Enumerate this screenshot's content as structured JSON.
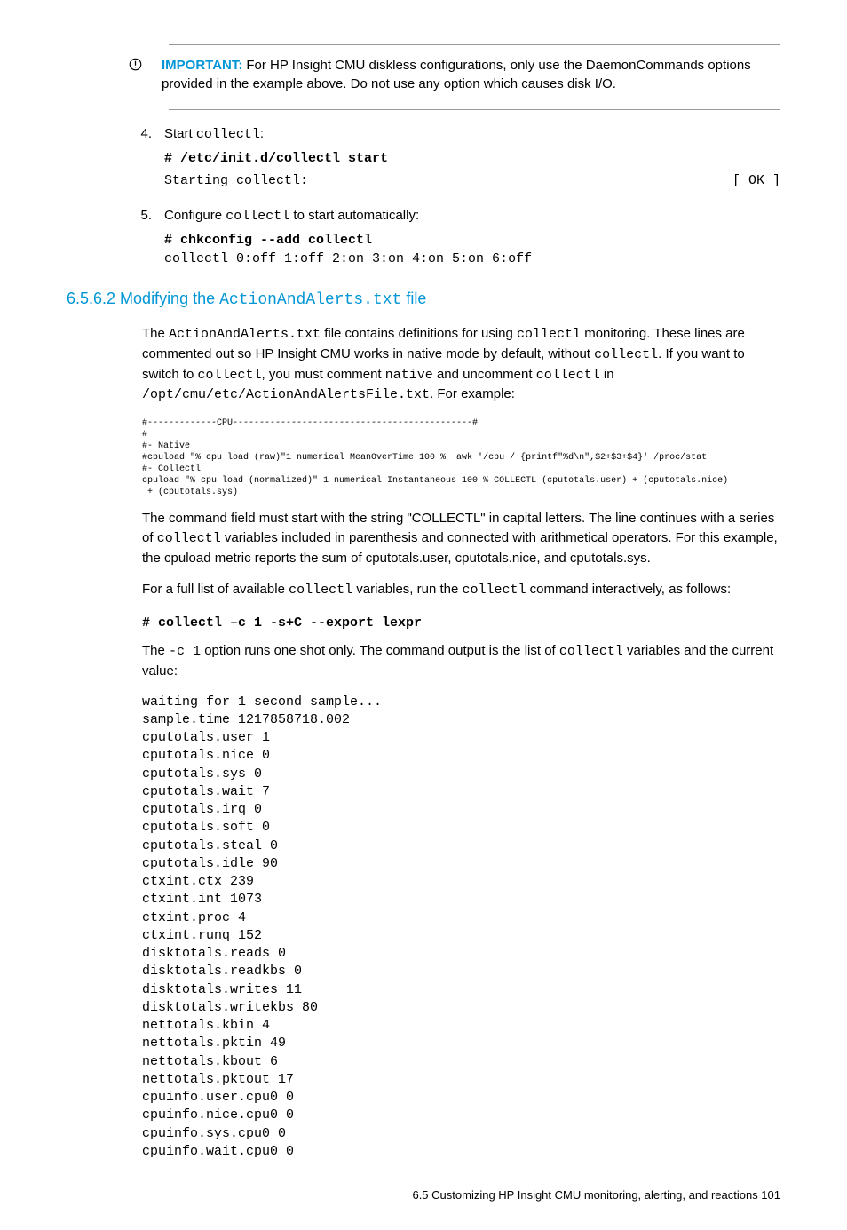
{
  "importantLabel": "IMPORTANT:",
  "importantText": "For HP Insight CMU diskless configurations, only use the DaemonCommands options provided in the example above. Do not use any option which causes disk I/O.",
  "step4": {
    "num": "4.",
    "textPre": "Start ",
    "code": "collectl",
    "textPost": ":",
    "cmd": "# /etc/init.d/collectl start",
    "outLeft": "Starting collectl:",
    "outRight": "[  OK  ]"
  },
  "step5": {
    "num": "5.",
    "textPre": "Configure ",
    "code": "collectl",
    "textPost": " to start automatically:",
    "cmd": "# chkconfig --add collectl",
    "out": "collectl 0:off 1:off 2:on 3:on 4:on 5:on 6:off"
  },
  "sectionNum": "6.5.6.2 Modifying the ",
  "sectionCode": "ActionAndAlerts.txt",
  "sectionPost": " file",
  "para1": {
    "a": "The ",
    "b": "ActionAndAlerts.txt",
    "c": " file contains definitions for using ",
    "d": "collectl",
    "e": " monitoring. These lines are commented out so HP Insight CMU works in native mode by default, without ",
    "f": "collectl",
    "g": ". If you want to switch to ",
    "h": "collectl",
    "i": ", you must comment ",
    "j": "native",
    "k": " and uncomment ",
    "l": "collectl",
    "m": " in ",
    "n": "/opt/cmu/etc/ActionAndAlertsFile.txt",
    "o": ". For example:"
  },
  "codeBlock1": "#-------------CPU---------------------------------------------#\n#\n#- Native\n#cpuload \"% cpu load (raw)\"1 numerical MeanOverTime 100 %  awk '/cpu / {printf\"%d\\n\",$2+$3+$4}' /proc/stat\n#- Collectl\ncpuload \"% cpu load (normalized)\" 1 numerical Instantaneous 100 % COLLECTL (cputotals.user) + (cputotals.nice)\n + (cputotals.sys)",
  "para2": {
    "a": "The command field must start with the string \"COLLECTL\" in capital letters. The line continues with a series of ",
    "b": "collectl",
    "c": " variables included in parenthesis and connected with arithmetical operators. For this example, the cpuload metric reports the sum of cputotals.user, cputotals.nice, and cputotals.sys."
  },
  "para3": {
    "a": "For a full list of available ",
    "b": "collectl",
    "c": " variables, run the ",
    "d": "collectl",
    "e": " command interactively, as follows:"
  },
  "cmd3": "# collectl –c 1 -s+C --export lexpr",
  "para4": {
    "a": "The ",
    "b": "-c 1",
    "c": " option runs one shot only. The command output is the list of ",
    "d": "collectl",
    "e": " variables and the current value:"
  },
  "output": "waiting for 1 second sample...\nsample.time 1217858718.002\ncputotals.user 1\ncputotals.nice 0\ncputotals.sys 0\ncputotals.wait 7\ncputotals.irq 0\ncputotals.soft 0\ncputotals.steal 0\ncputotals.idle 90\nctxint.ctx 239\nctxint.int 1073\nctxint.proc 4\nctxint.runq 152\ndisktotals.reads 0\ndisktotals.readkbs 0\ndisktotals.writes 11\ndisktotals.writekbs 80\nnettotals.kbin 4\nnettotals.pktin 49\nnettotals.kbout 6\nnettotals.pktout 17\ncpuinfo.user.cpu0 0\ncpuinfo.nice.cpu0 0\ncpuinfo.sys.cpu0 0\ncpuinfo.wait.cpu0 0",
  "footer": "6.5 Customizing HP Insight CMU monitoring, alerting, and reactions   101"
}
